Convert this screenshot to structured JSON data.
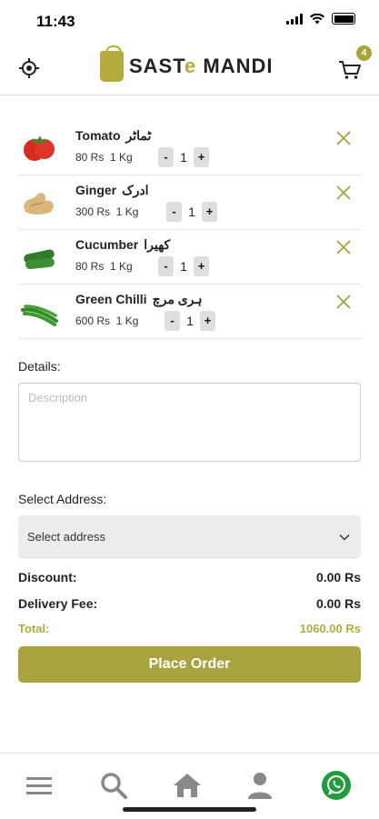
{
  "status": {
    "time": "11:43"
  },
  "header": {
    "brand_left": "SAST",
    "brand_e": "e",
    "brand_right": " MANDI",
    "cart_count": "4"
  },
  "items": [
    {
      "name": "Tomato",
      "urdu": "ٹماٹر",
      "price": "80 Rs",
      "unit": "1 Kg",
      "minus": "-",
      "qty": "1",
      "plus": "+"
    },
    {
      "name": "Ginger",
      "urdu": "ادرک",
      "price": "300 Rs",
      "unit": "1 Kg",
      "minus": "-",
      "qty": "1",
      "plus": "+"
    },
    {
      "name": "Cucumber",
      "urdu": "کھیرا",
      "price": "80 Rs",
      "unit": "1 Kg",
      "minus": "-",
      "qty": "1",
      "plus": "+"
    },
    {
      "name": "Green Chilli",
      "urdu": "ہری مرچ",
      "price": "600 Rs",
      "unit": "1 Kg",
      "minus": "-",
      "qty": "1",
      "plus": "+"
    }
  ],
  "details": {
    "label": "Details:",
    "placeholder": "Description"
  },
  "address": {
    "label": "Select Address:",
    "value": "Select address"
  },
  "summary": {
    "discount_label": "Discount:",
    "discount_value": "0.00 Rs",
    "delivery_label": "Delivery Fee:",
    "delivery_value": "0.00 Rs",
    "total_label": "Total:",
    "total_value": "1060.00 Rs"
  },
  "actions": {
    "place_order": "Place Order"
  },
  "colors": {
    "accent": "#a9a33f",
    "whatsapp": "#1f9d3a",
    "tab_icon": "#888888"
  },
  "tabs": [
    "menu-icon",
    "search-icon",
    "home-icon",
    "profile-icon",
    "whatsapp-icon"
  ]
}
